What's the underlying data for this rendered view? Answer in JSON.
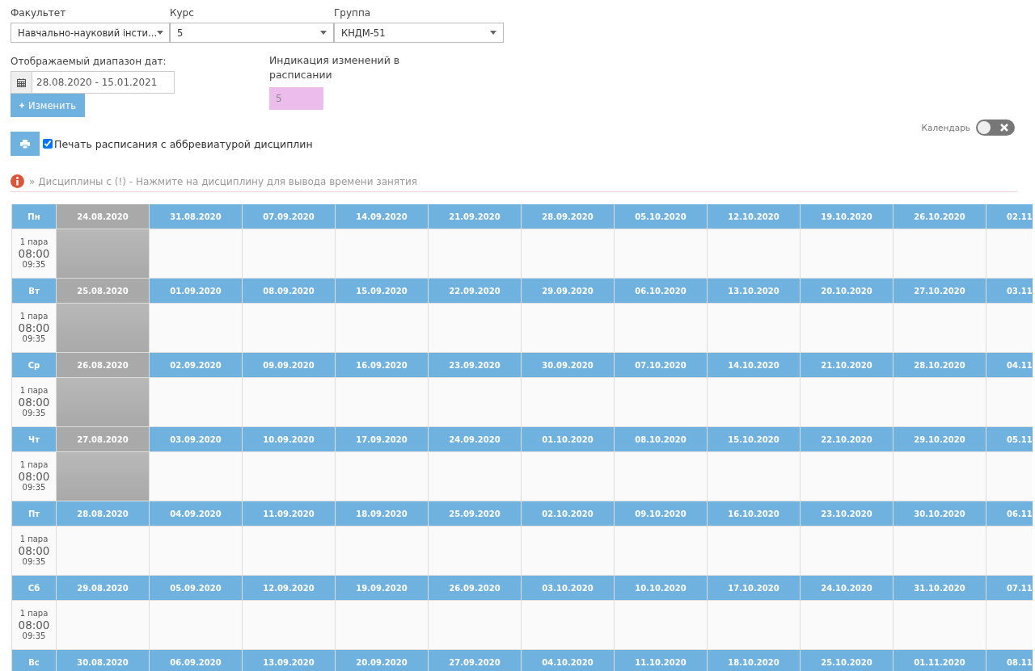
{
  "filters": [
    {
      "label": "Факультет",
      "value": "Навчально-науковий інсти..."
    },
    {
      "label": "Курс",
      "value": "5"
    },
    {
      "label": "Группа",
      "value": "КНДМ-51"
    }
  ],
  "date_range": {
    "label": "Отображаемый диапазон дат:",
    "value": "28.08.2020 - 15.01.2021",
    "button": "Изменить"
  },
  "changes": {
    "label": "Индикация изменений в расписании",
    "value": "5"
  },
  "print": {
    "label": "Печать расписания с аббревиатурой дисциплин",
    "checked": true
  },
  "calendar_toggle": {
    "label": "Календарь",
    "on": false
  },
  "info": "» Дисциплины с (!) - Нажмите на дисциплину для вывода времени занятия",
  "days": [
    {
      "day": "Пн",
      "slot": {
        "pair": "1 пара",
        "start": "08:00",
        "end": "09:35"
      },
      "dates": [
        {
          "label": "24.08.2020",
          "past": true
        },
        {
          "label": "31.08.2020",
          "past": false
        },
        {
          "label": "07.09.2020",
          "past": false
        },
        {
          "label": "14.09.2020",
          "past": false
        },
        {
          "label": "21.09.2020",
          "past": false
        },
        {
          "label": "28.09.2020",
          "past": false
        },
        {
          "label": "05.10.2020",
          "past": false
        },
        {
          "label": "12.10.2020",
          "past": false
        },
        {
          "label": "19.10.2020",
          "past": false
        },
        {
          "label": "26.10.2020",
          "past": false
        },
        {
          "label": "02.11",
          "past": false
        }
      ]
    },
    {
      "day": "Вт",
      "slot": {
        "pair": "1 пара",
        "start": "08:00",
        "end": "09:35"
      },
      "dates": [
        {
          "label": "25.08.2020",
          "past": true
        },
        {
          "label": "01.09.2020",
          "past": false
        },
        {
          "label": "08.09.2020",
          "past": false
        },
        {
          "label": "15.09.2020",
          "past": false
        },
        {
          "label": "22.09.2020",
          "past": false
        },
        {
          "label": "29.09.2020",
          "past": false
        },
        {
          "label": "06.10.2020",
          "past": false
        },
        {
          "label": "13.10.2020",
          "past": false
        },
        {
          "label": "20.10.2020",
          "past": false
        },
        {
          "label": "27.10.2020",
          "past": false
        },
        {
          "label": "03.11",
          "past": false
        }
      ]
    },
    {
      "day": "Ср",
      "slot": {
        "pair": "1 пара",
        "start": "08:00",
        "end": "09:35"
      },
      "dates": [
        {
          "label": "26.08.2020",
          "past": true
        },
        {
          "label": "02.09.2020",
          "past": false
        },
        {
          "label": "09.09.2020",
          "past": false
        },
        {
          "label": "16.09.2020",
          "past": false
        },
        {
          "label": "23.09.2020",
          "past": false
        },
        {
          "label": "30.09.2020",
          "past": false
        },
        {
          "label": "07.10.2020",
          "past": false
        },
        {
          "label": "14.10.2020",
          "past": false
        },
        {
          "label": "21.10.2020",
          "past": false
        },
        {
          "label": "28.10.2020",
          "past": false
        },
        {
          "label": "04.11",
          "past": false
        }
      ]
    },
    {
      "day": "Чт",
      "slot": {
        "pair": "1 пара",
        "start": "08:00",
        "end": "09:35"
      },
      "dates": [
        {
          "label": "27.08.2020",
          "past": true
        },
        {
          "label": "03.09.2020",
          "past": false
        },
        {
          "label": "10.09.2020",
          "past": false
        },
        {
          "label": "17.09.2020",
          "past": false
        },
        {
          "label": "24.09.2020",
          "past": false
        },
        {
          "label": "01.10.2020",
          "past": false
        },
        {
          "label": "08.10.2020",
          "past": false
        },
        {
          "label": "15.10.2020",
          "past": false
        },
        {
          "label": "22.10.2020",
          "past": false
        },
        {
          "label": "29.10.2020",
          "past": false
        },
        {
          "label": "05.11",
          "past": false
        }
      ]
    },
    {
      "day": "Пт",
      "slot": {
        "pair": "1 пара",
        "start": "08:00",
        "end": "09:35"
      },
      "dates": [
        {
          "label": "28.08.2020",
          "past": false
        },
        {
          "label": "04.09.2020",
          "past": false
        },
        {
          "label": "11.09.2020",
          "past": false
        },
        {
          "label": "18.09.2020",
          "past": false
        },
        {
          "label": "25.09.2020",
          "past": false
        },
        {
          "label": "02.10.2020",
          "past": false
        },
        {
          "label": "09.10.2020",
          "past": false
        },
        {
          "label": "16.10.2020",
          "past": false
        },
        {
          "label": "23.10.2020",
          "past": false
        },
        {
          "label": "30.10.2020",
          "past": false
        },
        {
          "label": "06.11",
          "past": false
        }
      ]
    },
    {
      "day": "Сб",
      "slot": {
        "pair": "1 пара",
        "start": "08:00",
        "end": "09:35"
      },
      "dates": [
        {
          "label": "29.08.2020",
          "past": false
        },
        {
          "label": "05.09.2020",
          "past": false
        },
        {
          "label": "12.09.2020",
          "past": false
        },
        {
          "label": "19.09.2020",
          "past": false
        },
        {
          "label": "26.09.2020",
          "past": false
        },
        {
          "label": "03.10.2020",
          "past": false
        },
        {
          "label": "10.10.2020",
          "past": false
        },
        {
          "label": "17.10.2020",
          "past": false
        },
        {
          "label": "24.10.2020",
          "past": false
        },
        {
          "label": "31.10.2020",
          "past": false
        },
        {
          "label": "07.11",
          "past": false
        }
      ]
    },
    {
      "day": "Вс",
      "dates": [
        {
          "label": "30.08.2020",
          "past": false
        },
        {
          "label": "06.09.2020",
          "past": false
        },
        {
          "label": "13.09.2020",
          "past": false
        },
        {
          "label": "20.09.2020",
          "past": false
        },
        {
          "label": "27.09.2020",
          "past": false
        },
        {
          "label": "04.10.2020",
          "past": false
        },
        {
          "label": "11.10.2020",
          "past": false
        },
        {
          "label": "18.10.2020",
          "past": false
        },
        {
          "label": "25.10.2020",
          "past": false
        },
        {
          "label": "01.11.2020",
          "past": false
        },
        {
          "label": "08.11",
          "past": false
        }
      ]
    }
  ]
}
